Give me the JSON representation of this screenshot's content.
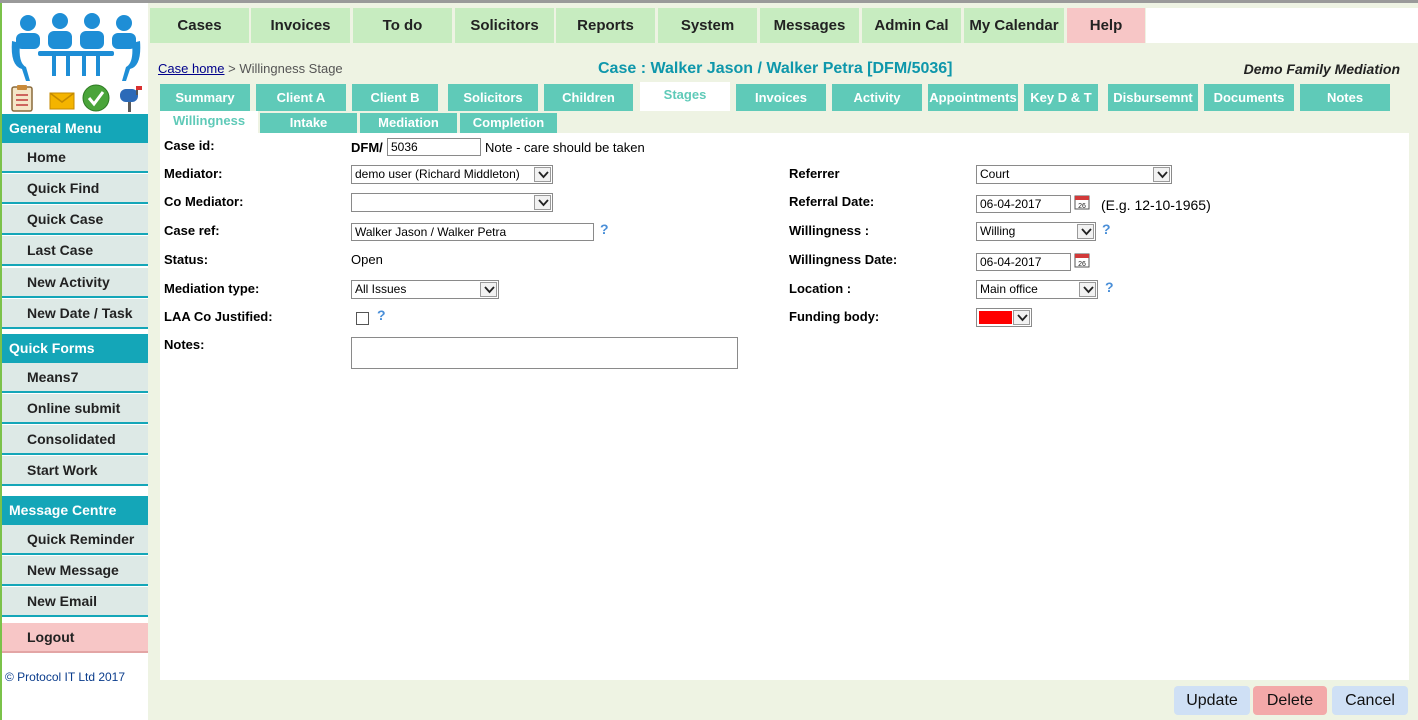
{
  "top_nav": {
    "items": [
      {
        "label": "Cases"
      },
      {
        "label": "Invoices"
      },
      {
        "label": "To do"
      },
      {
        "label": "Solicitors"
      },
      {
        "label": "Reports"
      },
      {
        "label": "System"
      },
      {
        "label": "Messages"
      },
      {
        "label": "Admin Cal"
      },
      {
        "label": "My Calendar"
      },
      {
        "label": "Help"
      }
    ]
  },
  "sidebar": {
    "general_menu": {
      "title": "General Menu",
      "items": [
        {
          "label": "Home"
        },
        {
          "label": "Quick Find"
        },
        {
          "label": "Quick Case"
        },
        {
          "label": "Last Case"
        },
        {
          "label": "New Activity"
        },
        {
          "label": "New Date / Task"
        }
      ]
    },
    "quick_forms": {
      "title": "Quick Forms",
      "items": [
        {
          "label": "Means7"
        },
        {
          "label": "Online submit"
        },
        {
          "label": "Consolidated"
        },
        {
          "label": "Start Work"
        }
      ]
    },
    "message_centre": {
      "title": "Message Centre",
      "items": [
        {
          "label": "Quick Reminder"
        },
        {
          "label": "New Message"
        },
        {
          "label": "New Email"
        }
      ]
    },
    "logout": "Logout",
    "copyright": "© Protocol IT Ltd 2017",
    "quick_icons": [
      "clipboard-icon",
      "envelope-icon",
      "checkmark-icon",
      "mailbox-icon"
    ]
  },
  "header": {
    "breadcrumb_link": "Case home",
    "breadcrumb_separator": ">",
    "breadcrumb_current": "Willingness Stage",
    "title": "Case : Walker Jason / Walker Petra [DFM/5036]",
    "org": "Demo Family Mediation"
  },
  "tabs": [
    {
      "label": "Summary"
    },
    {
      "label": "Client A"
    },
    {
      "label": "Client B"
    },
    {
      "label": "Solicitors"
    },
    {
      "label": "Children"
    },
    {
      "label": "Stages"
    },
    {
      "label": "Invoices"
    },
    {
      "label": "Activity"
    },
    {
      "label": "Appointments"
    },
    {
      "label": "Key D & T"
    },
    {
      "label": "Disbursemnt"
    },
    {
      "label": "Documents"
    },
    {
      "label": "Notes"
    }
  ],
  "subtabs": [
    {
      "label": "Willingness"
    },
    {
      "label": "Intake"
    },
    {
      "label": "Mediation"
    },
    {
      "label": "Completion"
    }
  ],
  "form": {
    "case_id": {
      "label": "Case id:",
      "prefix": "DFM/",
      "value": "5036",
      "note": "Note - care should be taken"
    },
    "mediator": {
      "label": "Mediator:",
      "value": "demo user (Richard Middleton)"
    },
    "co_mediator": {
      "label": "Co Mediator:",
      "value": ""
    },
    "case_ref": {
      "label": "Case ref:",
      "value": "Walker Jason / Walker Petra"
    },
    "status": {
      "label": "Status:",
      "value": "Open"
    },
    "mediation_type": {
      "label": "Mediation type:",
      "value": "All Issues"
    },
    "laa_co_justified": {
      "label": "LAA Co Justified:",
      "checked": false
    },
    "notes": {
      "label": "Notes:",
      "value": ""
    },
    "referrer": {
      "label": "Referrer",
      "value": "Court"
    },
    "referral_date": {
      "label": "Referral Date:",
      "value": "06-04-2017",
      "hint": "(E.g. 12-10-1965)"
    },
    "willingness": {
      "label": "Willingness :",
      "value": "Willing"
    },
    "willingness_date": {
      "label": "Willingness Date:",
      "value": "06-04-2017"
    },
    "location": {
      "label": "Location :",
      "value": "Main office"
    },
    "funding_body": {
      "label": "Funding body:",
      "color": "#ff0000"
    },
    "help_mark": "?"
  },
  "calendar_icon_day": "26",
  "buttons": {
    "update": "Update",
    "delete": "Delete",
    "cancel": "Cancel"
  },
  "colors": {
    "accent": "#14a6b8",
    "tab": "#5fcab8",
    "nav": "#c7ecc0",
    "help": "#f7c6c6",
    "title": "#0e97ab"
  }
}
